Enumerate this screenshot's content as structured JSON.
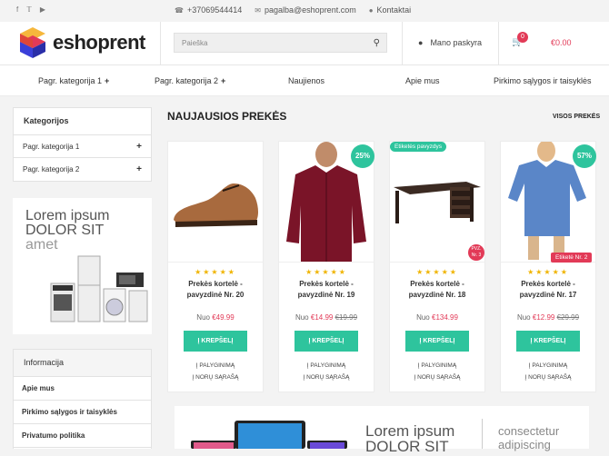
{
  "topbar": {
    "social": [
      "f",
      "t",
      "yt"
    ],
    "phone": "+37069544414",
    "email": "pagalba@eshoprent.com",
    "contacts_link": "Kontaktai"
  },
  "header": {
    "logo_text": "eshoprent",
    "search_placeholder": "Paieška",
    "account_label": "Mano paskyra",
    "cart_count": "0",
    "cart_total": "€0.00"
  },
  "nav": [
    "Pagr. kategorija 1",
    "Pagr. kategorija 2",
    "Naujienos",
    "Apie mus",
    "Pirkimo sąlygos ir taisyklės"
  ],
  "sidebar": {
    "categories_title": "Kategorijos",
    "categories": [
      "Pagr. kategorija 1",
      "Pagr. kategorija 2"
    ],
    "banner": {
      "line1": "Lorem ipsum",
      "line2": "DOLOR SIT",
      "line3": "amet"
    },
    "info_title": "Informacija",
    "info_items": [
      "Apie mus",
      "Pirkimo sąlygos ir taisyklės",
      "Privatumo politika"
    ]
  },
  "main": {
    "section_title": "NAUJAUSIOS PREKĖS",
    "view_all": "VISOS PREKĖS",
    "stars": "★★★★★",
    "buy_label": "Į KREPŠELĮ",
    "compare_label": "Į PALYGINIMĄ",
    "wishlist_label": "Į NORŲ SĄRAŠĄ",
    "products": [
      {
        "name": "Prekės kortelė - pavyzdinė Nr. 20",
        "price_prefix": "Nuo",
        "price": "€49.99",
        "old_price": "",
        "badge_pct": "",
        "badge_label": "",
        "badge_red": "",
        "badge_hex": ""
      },
      {
        "name": "Prekės kortelė - pavyzdinė Nr. 19",
        "price_prefix": "Nuo",
        "price": "€14.99",
        "old_price": "€19.99",
        "badge_pct": "25%",
        "badge_label": "",
        "badge_red": "",
        "badge_hex": ""
      },
      {
        "name": "Prekės kortelė - pavyzdinė Nr. 18",
        "price_prefix": "Nuo",
        "price": "€134.99",
        "old_price": "",
        "badge_pct": "",
        "badge_label": "Etiketės pavyzdys",
        "badge_red": "",
        "badge_hex": "PVZ. Nr. 3"
      },
      {
        "name": "Prekės kortelė - pavyzdinė Nr. 17",
        "price_prefix": "Nuo",
        "price": "€12.99",
        "old_price": "€29.99",
        "badge_pct": "57%",
        "badge_label": "",
        "badge_red": "Etiketė Nr. 2",
        "badge_hex": ""
      }
    ]
  },
  "bottom_banner": {
    "line1": "Lorem ipsum",
    "line2": "DOLOR SIT",
    "right1": "consectetur",
    "right2": "adipiscing"
  },
  "colors": {
    "accent": "#2ec49d",
    "sale": "#e23a57",
    "star": "#f0b400"
  }
}
